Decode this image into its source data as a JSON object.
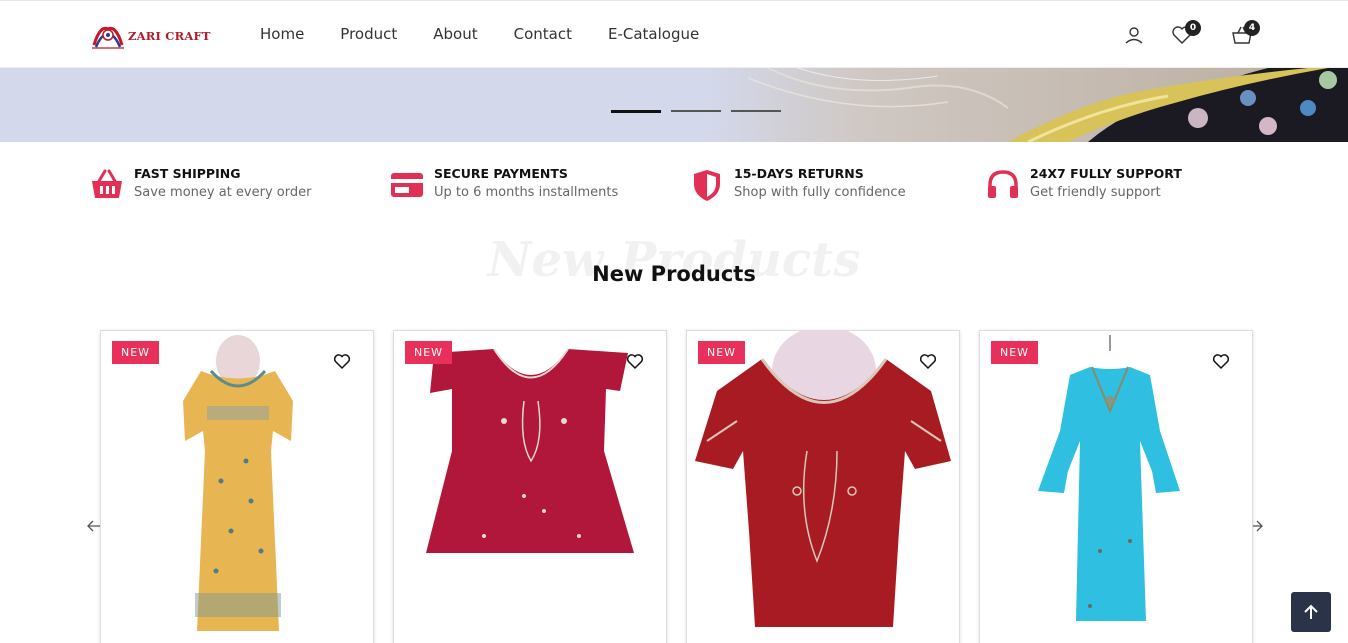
{
  "header": {
    "logo_text": "ZARI CRAFT",
    "nav": [
      "Home",
      "Product",
      "About",
      "Contact",
      "E-Catalogue"
    ],
    "wishlist_count": "0",
    "cart_count": "4"
  },
  "banner": {
    "slide_count": 3,
    "active_slide": 1
  },
  "features": [
    {
      "title": "FAST SHIPPING",
      "subtitle": "Save money at every order",
      "icon": "basket-icon"
    },
    {
      "title": "SECURE PAYMENTS",
      "subtitle": "Up to 6 months installments",
      "icon": "credit-card-icon"
    },
    {
      "title": "15-DAYS RETURNS",
      "subtitle": "Shop with fully confidence",
      "icon": "shield-icon"
    },
    {
      "title": "24X7 FULLY SUPPORT",
      "subtitle": "Get friendly support",
      "icon": "headphones-icon"
    }
  ],
  "products_section": {
    "watermark": "New Products",
    "title": "New Products",
    "items": [
      {
        "badge": "NEW",
        "color": "#e8b553",
        "style": "kurta"
      },
      {
        "badge": "NEW",
        "color": "#b0173a",
        "style": "top"
      },
      {
        "badge": "NEW",
        "color": "#a81b22",
        "style": "top-mannequin"
      },
      {
        "badge": "NEW",
        "color": "#2fbfe0",
        "style": "kurta-bell"
      }
    ]
  },
  "colors": {
    "accent": "#e8305a",
    "dark": "#2a3347"
  }
}
